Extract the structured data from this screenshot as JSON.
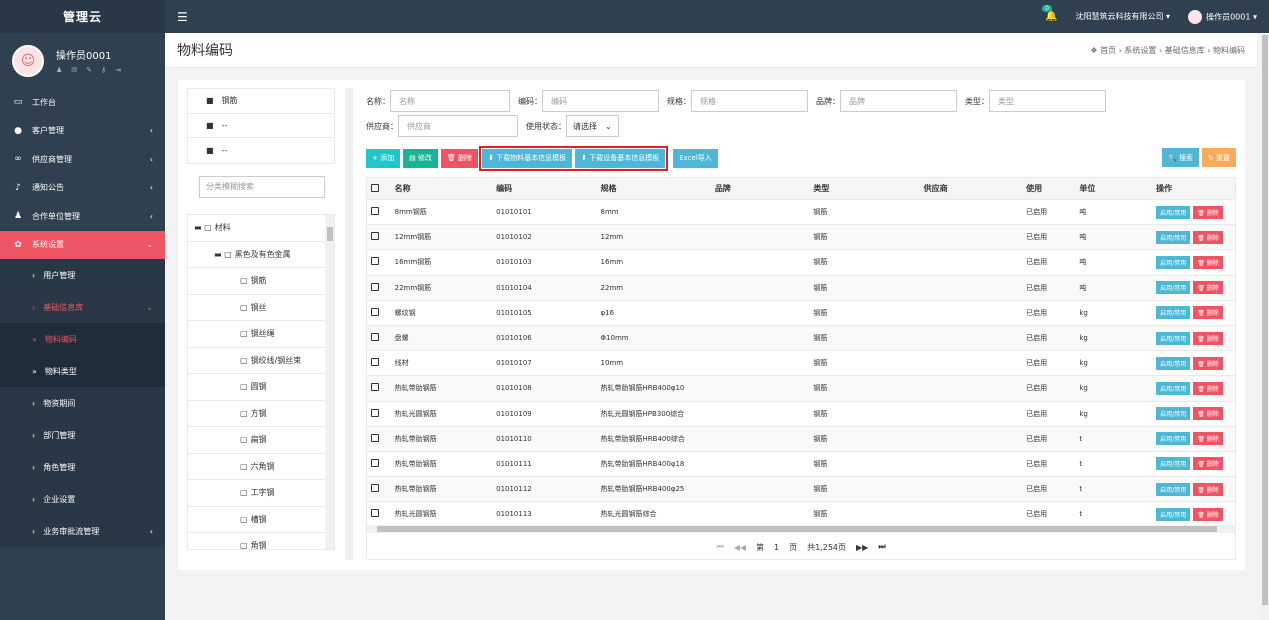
{
  "brand": "管理云",
  "profile": {
    "name": "操作员0001"
  },
  "menu": [
    {
      "label": "工作台",
      "icon": "monitor-icon",
      "glyph": "▭",
      "arrow": ""
    },
    {
      "label": "客户管理",
      "icon": "user-icon",
      "glyph": "●",
      "arrow": "‹"
    },
    {
      "label": "供应商管理",
      "icon": "link-icon",
      "glyph": "∞",
      "arrow": "‹"
    },
    {
      "label": "通知公告",
      "icon": "mic-icon",
      "glyph": "♪",
      "arrow": "‹"
    },
    {
      "label": "合作单位管理",
      "icon": "users-icon",
      "glyph": "♟",
      "arrow": "‹"
    },
    {
      "label": "系统设置",
      "icon": "gear-icon",
      "glyph": "✿",
      "arrow": "⌄"
    }
  ],
  "submenu": [
    {
      "label": "用户管理",
      "arrow": ""
    },
    {
      "label": "基础信息库",
      "arrow": "⌄"
    }
  ],
  "subsubmenu": [
    {
      "label": "物料编码"
    },
    {
      "label": "物料类型"
    }
  ],
  "submenu2": [
    {
      "label": "物资期间",
      "arrow": ""
    },
    {
      "label": "部门管理",
      "arrow": ""
    },
    {
      "label": "角色管理",
      "arrow": ""
    },
    {
      "label": "企业设置",
      "arrow": ""
    },
    {
      "label": "业务审批流管理",
      "arrow": "‹"
    }
  ],
  "topbar": {
    "badge": "0",
    "company": "沈阳慧筑云科技有限公司 ▾",
    "user": "操作员0001 ▾"
  },
  "header": {
    "title": "物料编码",
    "breadcrumb": "❖ 首页  ›  系统设置  ›  基础信息库  ›  物料编码"
  },
  "filter_list": [
    "钢筋",
    "--",
    "--"
  ],
  "filter_search_placeholder": "分类模糊搜索",
  "tree": [
    {
      "label": "材料",
      "indent": 6,
      "prefix": "▬ ▢"
    },
    {
      "label": "黑色及有色金属",
      "indent": 26,
      "prefix": "▬ ▢"
    },
    {
      "label": "钢筋",
      "indent": 52,
      "prefix": "▢"
    },
    {
      "label": "钢丝",
      "indent": 52,
      "prefix": "▢"
    },
    {
      "label": "钢丝绳",
      "indent": 52,
      "prefix": "▢"
    },
    {
      "label": "钢绞线/钢丝束",
      "indent": 52,
      "prefix": "▢"
    },
    {
      "label": "圆钢",
      "indent": 52,
      "prefix": "▢"
    },
    {
      "label": "方钢",
      "indent": 52,
      "prefix": "▢"
    },
    {
      "label": "扁钢",
      "indent": 52,
      "prefix": "▢"
    },
    {
      "label": "六角钢",
      "indent": 52,
      "prefix": "▢"
    },
    {
      "label": "工字钢",
      "indent": 52,
      "prefix": "▢"
    },
    {
      "label": "槽钢",
      "indent": 52,
      "prefix": "▢"
    },
    {
      "label": "角钢",
      "indent": 52,
      "prefix": "▢"
    }
  ],
  "form": {
    "name_label": "名称：",
    "name_ph": "名称",
    "code_label": "编码：",
    "code_ph": "编码",
    "spec_label": "规格：",
    "spec_ph": "规格",
    "brand_label": "品牌：",
    "brand_ph": "品牌",
    "type_label": "类型：",
    "type_ph": "类型",
    "supplier_label": "供应商：",
    "supplier_ph": "供应商",
    "status_label": "使用状态：",
    "status_value": "请选择"
  },
  "toolbar": {
    "add": "+ 添加",
    "edit": "▤ 修改",
    "delete": "🗑 删除",
    "download_material": "⬇ 下载物料基本信息模板",
    "download_equipment": "⬇ 下载设备基本信息模板",
    "excel": "Excel导入",
    "search": "🔍 搜索",
    "reset": "↻ 重置"
  },
  "table": {
    "headers": [
      "名称",
      "编码",
      "规格",
      "品牌",
      "类型",
      "供应商",
      "使用",
      "单位",
      "操作"
    ],
    "toggle_label": "启用/禁用",
    "delete_label": "🗑 删除",
    "rows": [
      {
        "name": "8mm钢筋",
        "code": "01010101",
        "spec": "8mm",
        "brand": "",
        "type": "钢筋",
        "supplier": "",
        "status": "已启用",
        "unit": "吨"
      },
      {
        "name": "12mm钢筋",
        "code": "01010102",
        "spec": "12mm",
        "brand": "",
        "type": "钢筋",
        "supplier": "",
        "status": "已启用",
        "unit": "吨"
      },
      {
        "name": "16mm钢筋",
        "code": "01010103",
        "spec": "16mm",
        "brand": "",
        "type": "钢筋",
        "supplier": "",
        "status": "已启用",
        "unit": "吨"
      },
      {
        "name": "22mm钢筋",
        "code": "01010104",
        "spec": "22mm",
        "brand": "",
        "type": "钢筋",
        "supplier": "",
        "status": "已启用",
        "unit": "吨"
      },
      {
        "name": "螺纹钢",
        "code": "01010105",
        "spec": "φ16",
        "brand": "",
        "type": "钢筋",
        "supplier": "",
        "status": "已启用",
        "unit": "kg"
      },
      {
        "name": "盘螺",
        "code": "01010106",
        "spec": "Φ10mm",
        "brand": "",
        "type": "钢筋",
        "supplier": "",
        "status": "已启用",
        "unit": "kg"
      },
      {
        "name": "线材",
        "code": "01010107",
        "spec": "10mm",
        "brand": "",
        "type": "钢筋",
        "supplier": "",
        "status": "已启用",
        "unit": "kg"
      },
      {
        "name": "热轧带肋钢筋",
        "code": "01010108",
        "spec": "热轧带肋钢筋HRB400φ10",
        "brand": "",
        "type": "钢筋",
        "supplier": "",
        "status": "已启用",
        "unit": "kg"
      },
      {
        "name": "热轧光圆钢筋",
        "code": "01010109",
        "spec": "热轧光圆钢筋HPB300综合",
        "brand": "",
        "type": "钢筋",
        "supplier": "",
        "status": "已启用",
        "unit": "kg"
      },
      {
        "name": "热轧带肋钢筋",
        "code": "01010110",
        "spec": "热轧带肋钢筋HRB400综合",
        "brand": "",
        "type": "钢筋",
        "supplier": "",
        "status": "已启用",
        "unit": "t"
      },
      {
        "name": "热轧带肋钢筋",
        "code": "01010111",
        "spec": "热轧带肋钢筋HRB400φ18",
        "brand": "",
        "type": "钢筋",
        "supplier": "",
        "status": "已启用",
        "unit": "t"
      },
      {
        "name": "热轧带肋钢筋",
        "code": "01010112",
        "spec": "热轧带肋钢筋HRB400φ25",
        "brand": "",
        "type": "钢筋",
        "supplier": "",
        "status": "已启用",
        "unit": "t"
      },
      {
        "name": "热轧光圆钢筋",
        "code": "01010113",
        "spec": "热轧光圆钢筋综合",
        "brand": "",
        "type": "钢筋",
        "supplier": "",
        "status": "已启用",
        "unit": "t"
      }
    ]
  },
  "pager": {
    "first": "⏮",
    "prev": "◀◀",
    "page_prefix": "第",
    "page": "1",
    "page_suffix": "页",
    "total": "共1,254页",
    "next": "▶▶",
    "last": "⏭"
  }
}
